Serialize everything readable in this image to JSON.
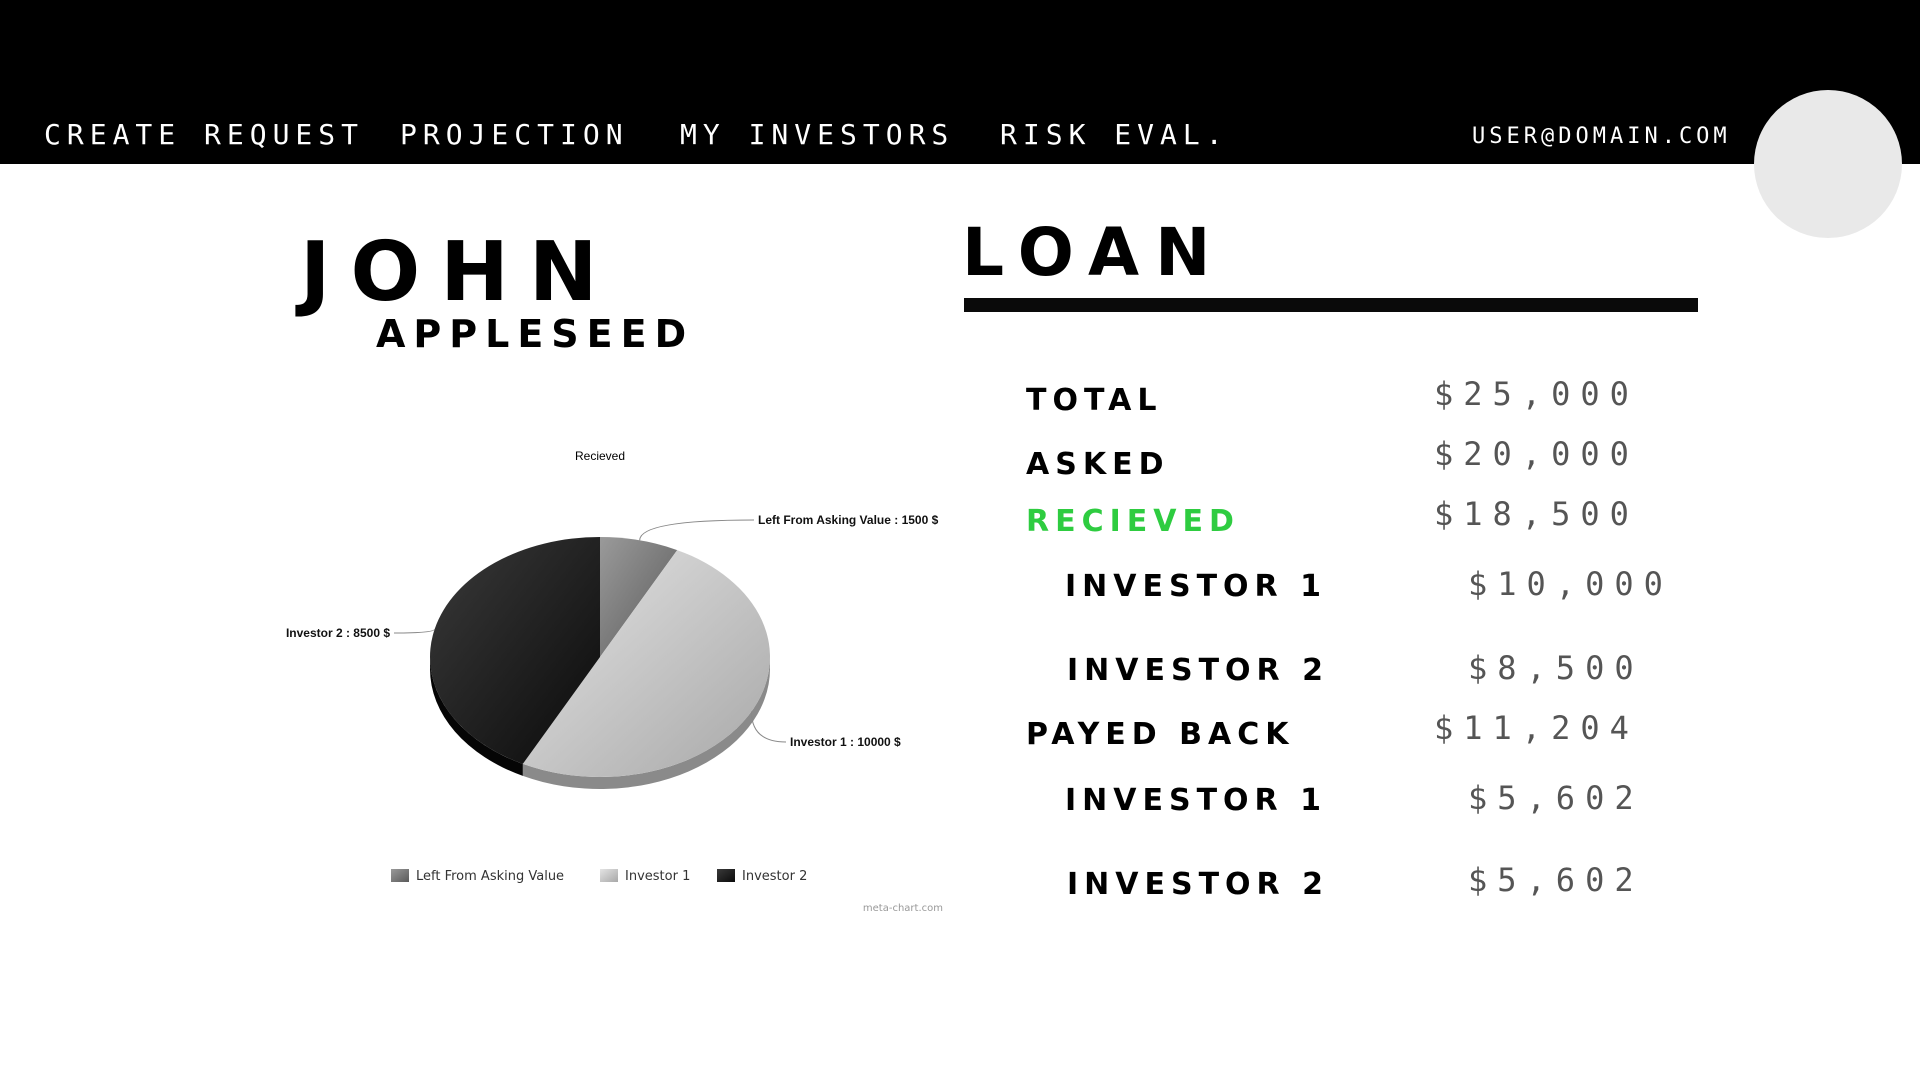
{
  "nav": {
    "create_request": "CREATE REQUEST",
    "projection": "PROJECTION",
    "my_investors": "MY INVESTORS",
    "risk_eval": "RISK EVAL."
  },
  "user": {
    "email": "USER@DOMAIN.COM"
  },
  "profile": {
    "first_name": "JOHN",
    "last_name": "APPLESEED"
  },
  "loan": {
    "title": "LOAN",
    "rows": [
      {
        "label": "TOTAL",
        "value": "$25,000"
      },
      {
        "label": "ASKED",
        "value": "$20,000"
      },
      {
        "label": "RECIEVED",
        "value": "$18,500"
      },
      {
        "label": "INVESTOR 1",
        "value": "$10,000"
      },
      {
        "label": "INVESTOR 2",
        "value": "$8,500"
      },
      {
        "label": "PAYED BACK",
        "value": "$11,204"
      },
      {
        "label": "INVESTOR 1",
        "value": "$5,602"
      },
      {
        "label": "INVESTOR 2",
        "value": "$5,602"
      }
    ]
  },
  "colors": {
    "highlight": "#2ecc40",
    "topbar": "#000000",
    "avatar": "#e9e9e9"
  },
  "chart_data": {
    "type": "pie",
    "title": "Recieved",
    "slices": [
      {
        "name": "Left From Asking Value",
        "value": 1500,
        "label": "Left From Asking Value : 1500 $",
        "color": "#777777"
      },
      {
        "name": "Investor 1",
        "value": 10000,
        "label": "Investor 1 : 10000 $",
        "color": "#c4c4c4"
      },
      {
        "name": "Investor 2",
        "value": 8500,
        "label": "Investor 2 : 8500 $",
        "color": "#222222"
      }
    ],
    "legend": [
      "Left From Asking Value",
      "Investor 1",
      "Investor 2"
    ],
    "legend_position": "bottom",
    "credit": "meta-chart.com"
  }
}
